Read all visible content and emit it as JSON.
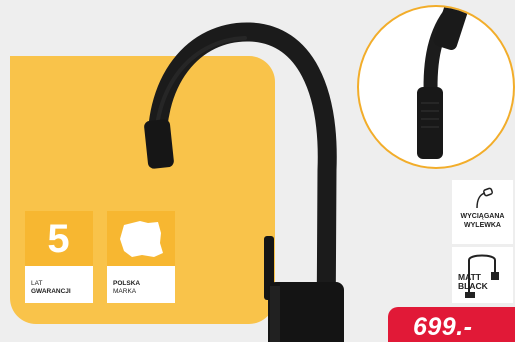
{
  "badges": {
    "warranty": {
      "number": "5",
      "line1": "LAT",
      "line2": "GWARANCJI"
    },
    "brand": {
      "line1": "POLSKA",
      "line2": "MARKA",
      "icon": "poland-map-icon"
    }
  },
  "features": {
    "pull_out_spout": {
      "line1": "WYCIĄGANA",
      "line2": "WYLEWKA",
      "icon": "pull-out-spout-icon"
    },
    "finish": {
      "line1": "MATT",
      "line2": "BLACK",
      "icon": "faucet-outline-icon"
    }
  },
  "price": {
    "text": "699.-"
  },
  "colors": {
    "yellow": "#f9c34a",
    "badge_yellow": "#f7b731",
    "price_red": "#e11937",
    "faucet": "#141414"
  }
}
